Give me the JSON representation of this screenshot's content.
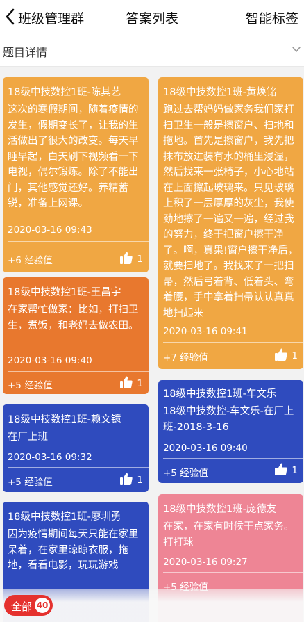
{
  "nav": {
    "back_label": "班级管理群",
    "title": "答案列表",
    "right_label": "智能标签"
  },
  "detail": {
    "label": "题目详情"
  },
  "cards": [
    {
      "name": "18级中技数控1班-陈其艺",
      "body": "这次的寒假期间，随着疫情的发生，假期变长了，让我的生活做出了很大的改变。每天早睡早起，白天刷下视频看一下电视，偶尔锻炼。除了不能出门，其他感觉还好。养精蓄锐，准备上网课。",
      "date": "2020-03-16 09:43",
      "exp": "+6 经验值",
      "likes": "1",
      "color": "#f0a743"
    },
    {
      "name": "18级中技数控1班-王昌宇",
      "body": "在家帮忙做家：比如，打扫卫生，煮饭，和老妈去做农田。",
      "date": "2020-03-16 09:40",
      "exp": "+5 经验值",
      "likes": "1",
      "color": "#e8782e"
    },
    {
      "name": "18级中技数控1班-赖文镱",
      "body": "在厂上班",
      "date": "2020-03-16 09:32",
      "exp": "+5 经验值",
      "likes": "1",
      "color": "#2f4bbe"
    },
    {
      "name": "18级中技数控1班-廖圳勇",
      "body": "因为疫情期间每天只能在家里呆着，在家里晾晾衣服，拖地，看看电影，玩玩游戏",
      "date": "",
      "exp": "",
      "likes": "",
      "color": "#2f4bbe"
    },
    {
      "name": "18级中技数控1班-黄焕铭",
      "body": "跑过去帮妈妈做家务我们家打扫卫生一般是擦窗户、扫地和拖地。首先是擦窗户，我先把抹布放进装有水的桶里浸湿，然后找来一张椅子，小心地站在上面擦起玻璃来。只见玻璃上积了一层厚厚的灰尘，我使劲地擦了一遍又一遍，经过我的努力，终于把窗户擦干净了。啊，真果!窗户擦干净后，就要扫地了。我找来了一把扫帚，然后弓着背、低着头、弯着腰，手中拿着扫帚认认真真地扫起来",
      "date": "2020-03-16 09:41",
      "exp": "+7 经验值",
      "likes": "1",
      "color": "#f0a743"
    },
    {
      "name": "18级中技数控1班-车文乐",
      "body": "18级中技数控-车文乐-在厂上班-2018-3-16",
      "date": "2020-03-16 09:40",
      "exp": "+5 经验值",
      "likes": "1",
      "color": "#2f4bbe"
    },
    {
      "name": "18级中技数控1班-庞德友",
      "body": "在家，在家有时候干点家务。打打球",
      "date": "2020-03-16 09:27",
      "exp": "+5 经验值",
      "likes": "",
      "color": "#ee8595"
    }
  ],
  "bottom": {
    "all_label": "全部",
    "count": "40"
  }
}
